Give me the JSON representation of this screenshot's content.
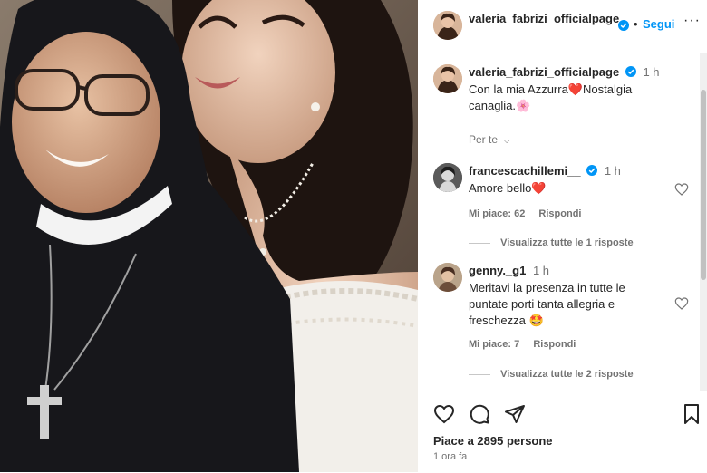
{
  "post": {
    "username": "valeria_fabrizi_officialpage",
    "follow_label": "Segui",
    "dot": "•",
    "more": "···",
    "caption": {
      "username": "valeria_fabrizi_officialpage",
      "time": "1 h",
      "text_line1": "Con la mia Azzurra❤️Nostalgia",
      "text_line2": "canaglia.🌸"
    },
    "see_translation": "Per te"
  },
  "comments": [
    {
      "username": "francescachillemi__",
      "time": "1 h",
      "text_line1": "Amore bello❤️",
      "text_line2": "",
      "text_line3": "",
      "likes": "Mi piace: 62",
      "reply": "Rispondi",
      "view_replies": "Visualizza tutte le 1 risposte"
    },
    {
      "username": "genny._g1",
      "time": "1 h",
      "text_line1": "Meritavi la presenza in tutte le",
      "text_line2": "puntate porti tanta allegria e",
      "text_line3": "freschezza 🤩",
      "likes": "Mi piace: 7",
      "reply": "Rispondi",
      "view_replies": "Visualizza tutte le 2 risposte"
    }
  ],
  "footer": {
    "likes": "Piace a 2895 persone",
    "time_ago": "1 ora fa"
  },
  "colors": {
    "accent": "#0095f6",
    "verified": "#0095f6",
    "muted": "#737373",
    "border": "#dbdbdb"
  },
  "icons": [
    "heart-icon",
    "comment-icon",
    "share-icon",
    "bookmark-icon",
    "verified-icon",
    "more-icon"
  ]
}
